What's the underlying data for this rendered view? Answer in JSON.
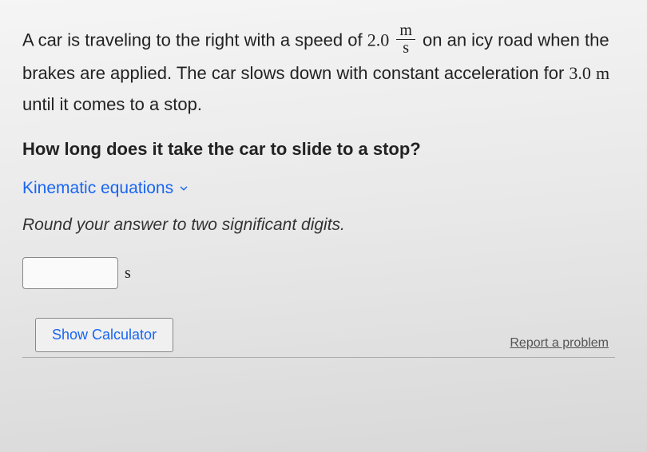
{
  "problem": {
    "part1_before": "A car is traveling to the right with a speed of ",
    "speed_value": "2.0",
    "speed_unit_num": "m",
    "speed_unit_den": "s",
    "part1_after": " on an icy road when the brakes are applied. The car slows down with constant acceleration for ",
    "distance_value": "3.0",
    "distance_unit": "m",
    "part1_end": " until it comes to a stop."
  },
  "question": "How long does it take the car to slide to a stop?",
  "kinematic_link": "Kinematic equations",
  "instruction": "Round your answer to two significant digits.",
  "answer_unit": "s",
  "calculator_button": "Show Calculator",
  "report_link": "Report a problem"
}
